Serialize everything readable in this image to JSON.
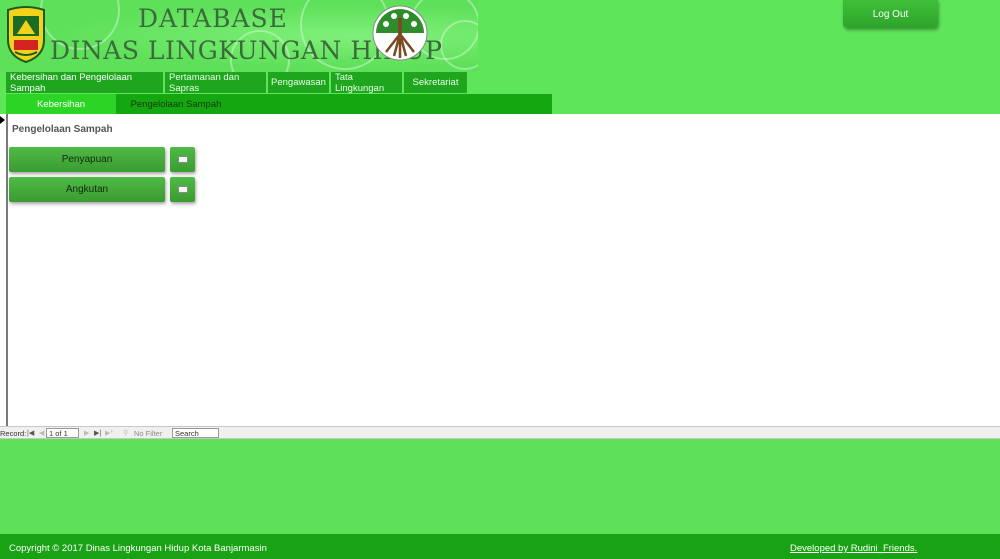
{
  "header": {
    "title_line1": "DATABASE",
    "title_line2": "DINAS LINGKUNGAN HIDUP",
    "left_logo_icon": "banjarmasin-crest-icon",
    "right_logo_icon": "tree-roots-emblem-icon"
  },
  "logout_label": "Log Out",
  "tabs": [
    {
      "label": "Kebersihan dan Pengelolaan Sampah"
    },
    {
      "label": "Pertamanan dan Sapras"
    },
    {
      "label": "Pengawasan"
    },
    {
      "label": "Tata Lingkungan"
    },
    {
      "label": "Sekretariat"
    }
  ],
  "subtabs": [
    {
      "label": "Kebersihan"
    },
    {
      "label": "Pengelolaan Sampah"
    }
  ],
  "form": {
    "section_title": "Pengelolaan Sampah",
    "buttons": [
      {
        "label": "Penyapuan",
        "side_icon": "form-icon"
      },
      {
        "label": "Angkutan",
        "side_icon": "form-icon"
      }
    ]
  },
  "record_nav": {
    "label": "Record:",
    "position": "1 of 1",
    "filter": "No Filter",
    "search": "Search"
  },
  "footer": {
    "copyright": "Copyright © 2017 Dinas Lingkungan Hidup Kota Banjarmasin",
    "developer": "Developed by Rudini_Friends."
  },
  "colors": {
    "background": "#5fe05a",
    "tab": "#1fa51e",
    "active_subtab": "#2cd426",
    "footer": "#19a213"
  }
}
